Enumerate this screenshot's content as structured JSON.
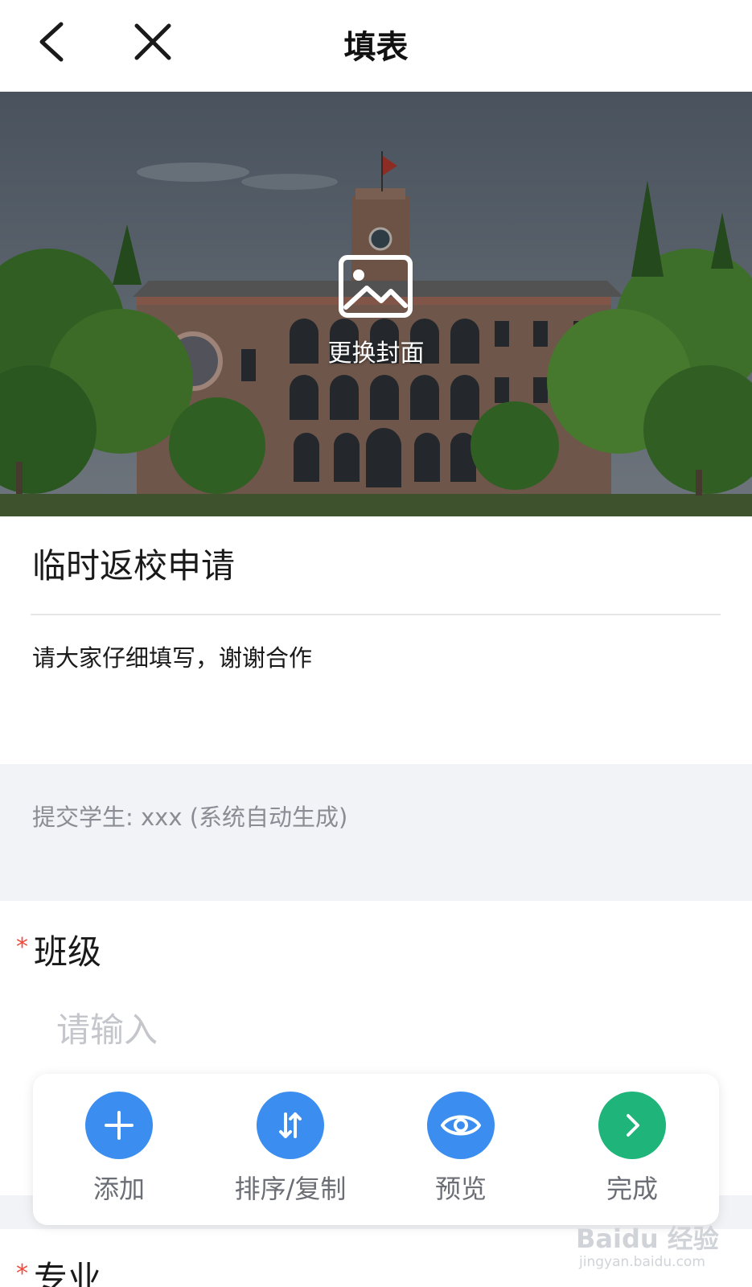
{
  "header": {
    "title": "填表"
  },
  "cover": {
    "change_label": "更换封面"
  },
  "form": {
    "title": "临时返校申请",
    "description": "请大家仔细填写，谢谢合作",
    "submitter_note": "提交学生: xxx (系统自动生成)"
  },
  "fields": [
    {
      "required_mark": "*",
      "label": "班级",
      "placeholder": "请输入"
    },
    {
      "required_mark": "*",
      "label": "专业"
    }
  ],
  "toolbar": {
    "add_label": "添加",
    "sort_label": "排序/复制",
    "preview_label": "预览",
    "done_label": "完成"
  },
  "watermark": {
    "brand": "Baidu 经验",
    "url": "jingyan.baidu.com"
  },
  "colors": {
    "primary_blue": "#3b8ef0",
    "done_green": "#1fb47a",
    "required_red": "#f04b3d",
    "band_grey": "#f2f3f7"
  },
  "icons": {
    "back": "chevron-left-icon",
    "close": "close-icon",
    "cover": "image-icon",
    "add": "plus-icon",
    "sort": "sort-arrows-icon",
    "preview": "eye-icon",
    "done": "chevron-right-icon"
  }
}
